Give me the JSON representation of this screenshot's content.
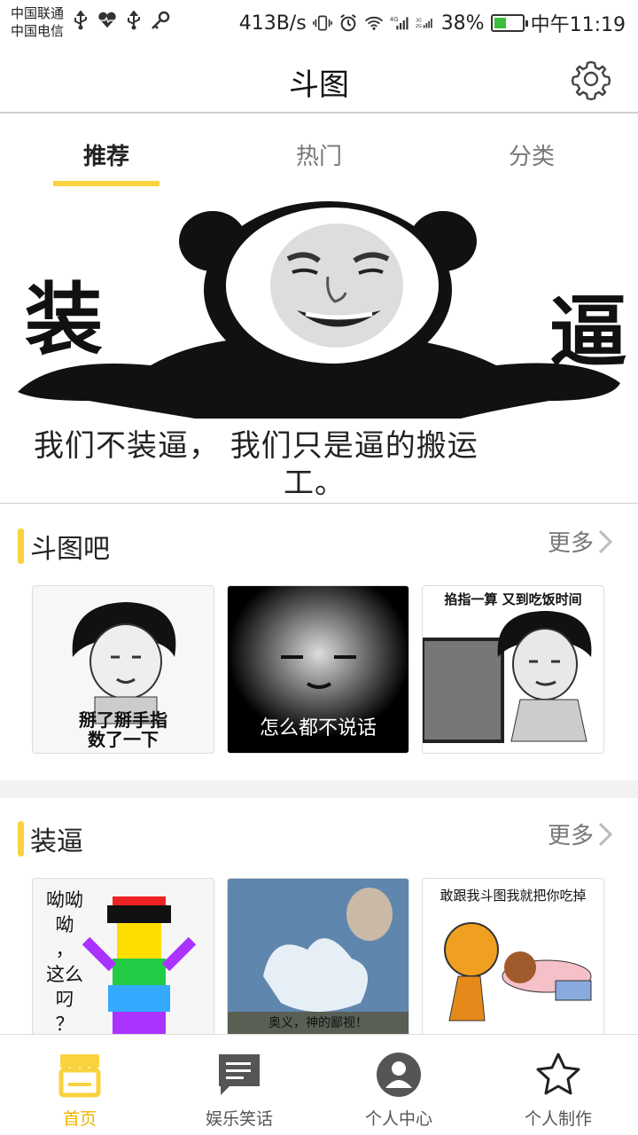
{
  "status_bar": {
    "carrier_1": "中国联通",
    "carrier_2": "中国电信",
    "speed": "413B/s",
    "signal_labels": "4G 3G 2G",
    "battery": "38%",
    "time": "中午11:19"
  },
  "header": {
    "title": "斗图"
  },
  "tabs": [
    {
      "label": "推荐"
    },
    {
      "label": "热门"
    },
    {
      "label": "分类"
    }
  ],
  "banner": {
    "word_left": "装",
    "word_right": "逼",
    "caption": "我们不装逼， 我们只是逼的搬运",
    "caption_cont": "工。"
  },
  "sections": [
    {
      "name": "斗图吧",
      "more": "更多",
      "thumbs": [
        {
          "caption": "掰了掰手指\n数了一下"
        },
        {
          "caption": "怎么都不说话"
        },
        {
          "caption": "掐指一算 又到吃饭时间"
        }
      ]
    },
    {
      "name": "装逼",
      "more": "更多",
      "thumbs": [
        {
          "caption": "呦呦\n呦\n，\n这么\n叼\n？"
        },
        {
          "caption": "奥义，神的鄙视！"
        },
        {
          "caption": "敢跟我斗图我就把你吃掉"
        }
      ]
    }
  ],
  "bottom_nav": [
    {
      "label": "首页",
      "icon": "store-icon",
      "active": true
    },
    {
      "label": "娱乐笑话",
      "icon": "message-icon",
      "active": false
    },
    {
      "label": "个人中心",
      "icon": "person-icon",
      "active": false
    },
    {
      "label": "个人制作",
      "icon": "star-icon",
      "active": false
    }
  ],
  "colors": {
    "accent": "#f9d33d",
    "active_nav": "#f0b400"
  }
}
